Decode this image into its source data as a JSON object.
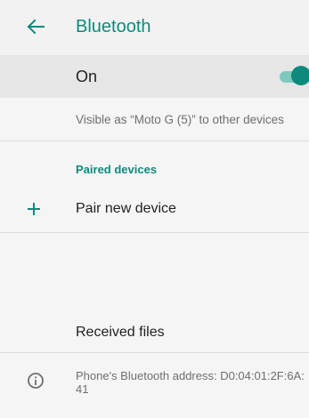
{
  "appbar": {
    "title": "Bluetooth",
    "back_icon": "arrow-left-icon",
    "accent_color": "#0e8a7d"
  },
  "toggle_row": {
    "label": "On",
    "enabled": true
  },
  "visibility_text": "Visible as “Moto G (5)” to other devices",
  "paired_section": {
    "header": "Paired devices",
    "pair_new": {
      "icon": "plus-icon",
      "label": "Pair new device"
    }
  },
  "received_files": {
    "label": "Received files"
  },
  "address_info": {
    "icon": "info-icon",
    "text": "Phone's Bluetooth address: D0:04:01:2F:6A:41"
  }
}
